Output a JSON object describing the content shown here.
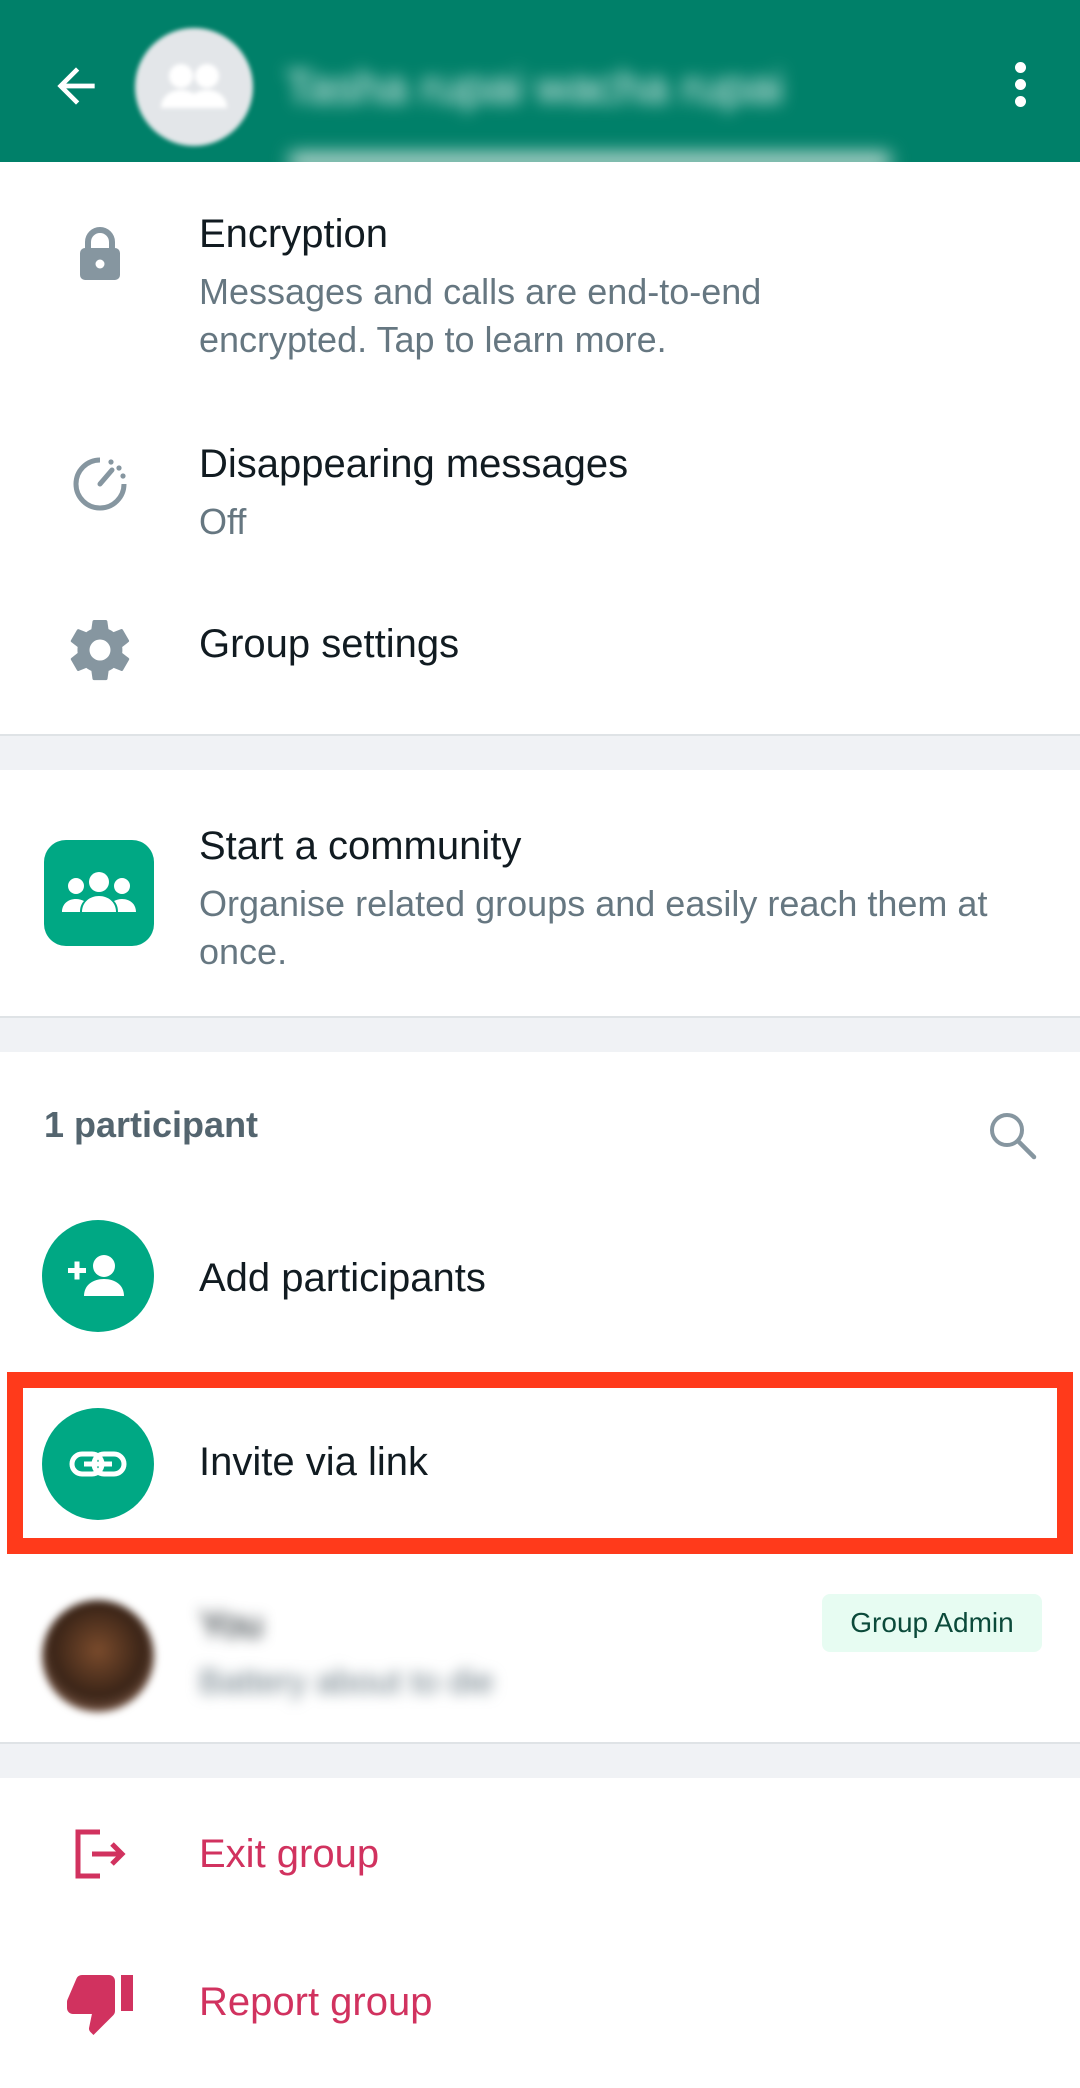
{
  "header": {
    "group_name": "Tasha rupai wacha rupai"
  },
  "settings": {
    "encryption": {
      "title": "Encryption",
      "subtitle": "Messages and calls are end-to-end encrypted. Tap to learn more."
    },
    "disappearing": {
      "title": "Disappearing messages",
      "subtitle": "Off"
    },
    "group_settings": {
      "title": "Group settings"
    }
  },
  "community": {
    "title": "Start a community",
    "subtitle": "Organise related groups and easily reach them at once."
  },
  "participants": {
    "count_label": "1 participant",
    "add_label": "Add participants",
    "invite_label": "Invite via link",
    "members": [
      {
        "name": "You",
        "status": "Battery about to die",
        "badge": "Group Admin"
      }
    ]
  },
  "actions": {
    "exit_label": "Exit group",
    "report_label": "Report group"
  },
  "colors": {
    "appbar": "#008069",
    "accent": "#00a884",
    "danger": "#d1325f",
    "highlight": "#ff3a1b"
  },
  "icons": {
    "back": "arrow-left-icon",
    "menu": "more-vertical-icon",
    "encryption": "lock-icon",
    "disappearing": "timer-icon",
    "settings": "gear-icon",
    "community": "community-icon",
    "search": "search-icon",
    "add": "add-person-icon",
    "invite": "link-icon",
    "exit": "exit-icon",
    "report": "thumbs-down-icon"
  }
}
